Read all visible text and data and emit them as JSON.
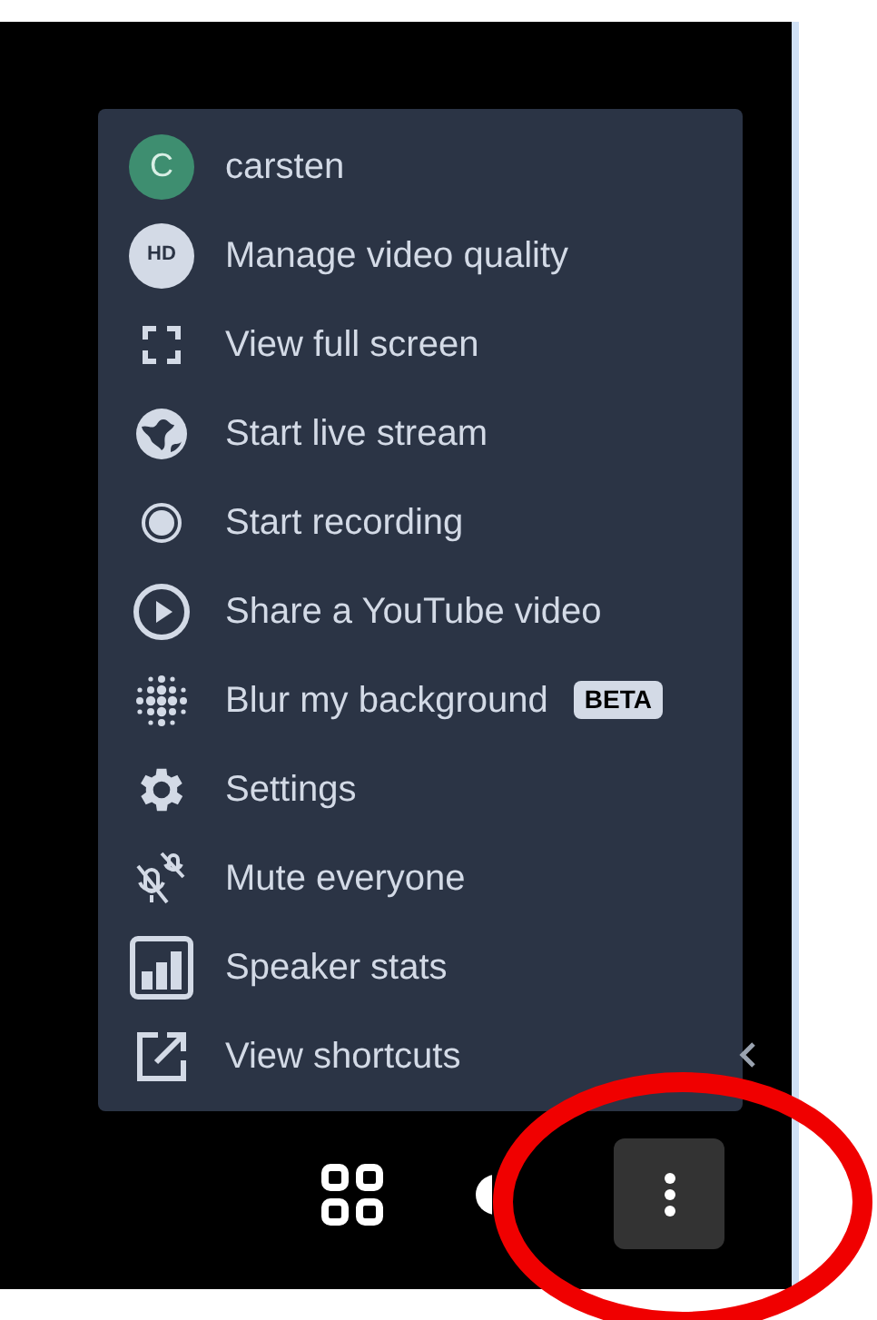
{
  "menu": {
    "items": [
      {
        "kind": "avatar",
        "avatar_text": "C",
        "label": "carsten"
      },
      {
        "kind": "badge-icon",
        "icon_text": "HD",
        "label": "Manage video quality"
      },
      {
        "kind": "icon",
        "label": "View full screen"
      },
      {
        "kind": "icon",
        "label": "Start live stream"
      },
      {
        "kind": "icon",
        "label": "Start recording"
      },
      {
        "kind": "icon",
        "label": "Share a YouTube video"
      },
      {
        "kind": "icon",
        "label": "Blur my background",
        "badge": "BETA"
      },
      {
        "kind": "icon",
        "label": "Settings"
      },
      {
        "kind": "icon",
        "label": "Mute everyone"
      },
      {
        "kind": "icon",
        "label": "Speaker stats"
      },
      {
        "kind": "icon",
        "label": "View shortcuts"
      }
    ]
  },
  "toolbar_buttons": [
    {
      "selected": false
    },
    {
      "selected": false
    },
    {
      "selected": true
    }
  ]
}
